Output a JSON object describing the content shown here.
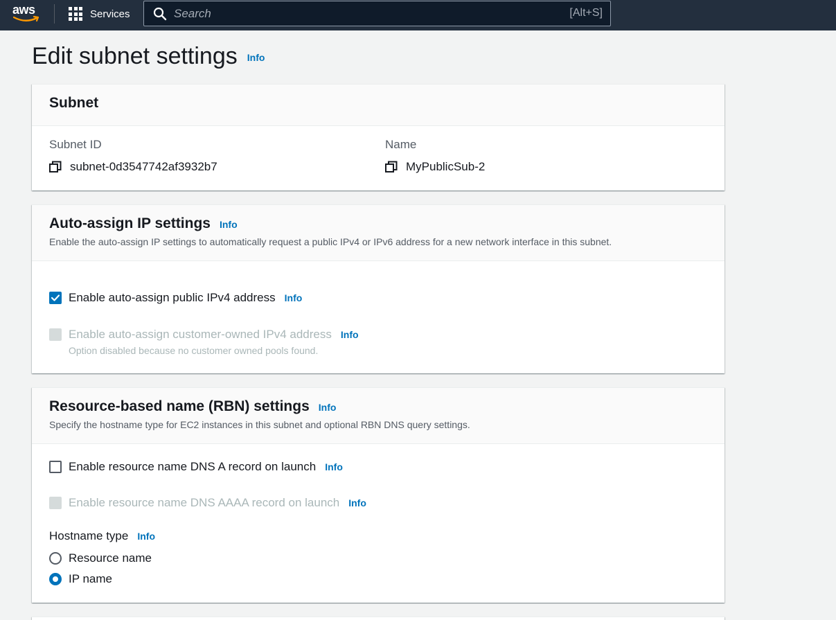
{
  "nav": {
    "logo_text": "aws",
    "services_label": "Services",
    "search_placeholder": "Search",
    "search_shortcut": "[Alt+S]"
  },
  "page": {
    "title": "Edit subnet settings",
    "info_label": "Info"
  },
  "subnet_card": {
    "title": "Subnet",
    "subnet_id_label": "Subnet ID",
    "subnet_id_value": "subnet-0d3547742af3932b7",
    "name_label": "Name",
    "name_value": "MyPublicSub-2"
  },
  "auto_assign_card": {
    "title": "Auto-assign IP settings",
    "info_label": "Info",
    "description": "Enable the auto-assign IP settings to automatically request a public IPv4 or IPv6 address for a new network interface in this subnet.",
    "options": [
      {
        "label": "Enable auto-assign public IPv4 address",
        "info": "Info",
        "checked": true,
        "disabled": false
      },
      {
        "label": "Enable auto-assign customer-owned IPv4 address",
        "info": "Info",
        "checked": false,
        "disabled": true,
        "hint": "Option disabled because no customer owned pools found."
      }
    ]
  },
  "rbn_card": {
    "title": "Resource-based name (RBN) settings",
    "info_label": "Info",
    "description": "Specify the hostname type for EC2 instances in this subnet and optional RBN DNS query settings.",
    "options": [
      {
        "label": "Enable resource name DNS A record on launch",
        "info": "Info",
        "checked": false,
        "disabled": false
      },
      {
        "label": "Enable resource name DNS AAAA record on launch",
        "info": "Info",
        "checked": false,
        "disabled": true
      }
    ],
    "hostname_type_label": "Hostname type",
    "hostname_info": "Info",
    "hostname_options": [
      {
        "label": "Resource name",
        "selected": false
      },
      {
        "label": "IP name",
        "selected": true
      }
    ]
  },
  "colors": {
    "nav_bg": "#232f3e",
    "accent": "#0073bb",
    "page_bg": "#f2f3f3",
    "smile": "#ff9900"
  }
}
